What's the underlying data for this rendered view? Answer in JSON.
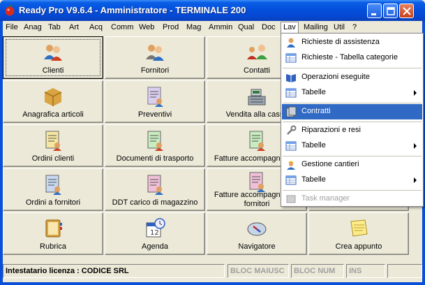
{
  "window": {
    "title": "Ready Pro V9.6.4 - Amministratore - TERMINALE 200"
  },
  "menubar": [
    {
      "label": "File"
    },
    {
      "label": "Anag"
    },
    {
      "label": "Tab"
    },
    {
      "label": "Art"
    },
    {
      "label": "Acq"
    },
    {
      "label": "Comm"
    },
    {
      "label": "Web"
    },
    {
      "label": "Prod"
    },
    {
      "label": "Mag"
    },
    {
      "label": "Ammin"
    },
    {
      "label": "Qual"
    },
    {
      "label": "Doc"
    },
    {
      "label": "Lav"
    },
    {
      "label": "Mailing"
    },
    {
      "label": "Util"
    },
    {
      "label": "?"
    }
  ],
  "tiles": [
    {
      "label": "Clienti",
      "icon": "users-icon"
    },
    {
      "label": "Fornitori",
      "icon": "suppliers-icon"
    },
    {
      "label": "Contatti",
      "icon": "contacts-icon"
    },
    {
      "label": "Anagrafica articoli",
      "icon": "box-icon"
    },
    {
      "label": "Preventivi",
      "icon": "quote-document-icon"
    },
    {
      "label": "Vendita alla cassa",
      "icon": "cash-register-icon"
    },
    {
      "label": "Ordini clienti",
      "icon": "order-document-icon"
    },
    {
      "label": "Documenti di trasporto",
      "icon": "transport-document-icon"
    },
    {
      "label": "Fatture accompagnatorie",
      "icon": "invoice-document-icon"
    },
    {
      "label": "Ordini a fornitori",
      "icon": "supplier-order-icon"
    },
    {
      "label": "DDT carico di magazzino",
      "icon": "warehouse-document-icon"
    },
    {
      "label": "Fatture accompagnatorie fornitori",
      "icon": "supplier-invoice-icon"
    },
    {
      "label": "Rubrica",
      "icon": "address-book-icon"
    },
    {
      "label": "Agenda",
      "icon": "calendar-clock-icon"
    },
    {
      "label": "Navigatore",
      "icon": "compass-icon"
    },
    {
      "label": "Crea appunto",
      "icon": "note-icon"
    }
  ],
  "dropdown": {
    "items": [
      {
        "label": "Richieste di assistenza",
        "icon": "person-icon",
        "submenu": false,
        "highlighted": false,
        "disabled": false
      },
      {
        "label": "Richieste - Tabella categorie",
        "icon": "table-icon",
        "submenu": false,
        "highlighted": false,
        "disabled": false
      },
      {
        "label": "Operazioni eseguite",
        "icon": "book-icon",
        "submenu": false,
        "highlighted": false,
        "disabled": false
      },
      {
        "label": "Tabelle",
        "icon": "table-icon",
        "submenu": true,
        "highlighted": false,
        "disabled": false
      },
      {
        "label": "Contratti",
        "icon": "contract-icon",
        "submenu": false,
        "highlighted": true,
        "disabled": false
      },
      {
        "label": "Riparazioni e resi",
        "icon": "wrench-icon",
        "submenu": false,
        "highlighted": false,
        "disabled": false
      },
      {
        "label": "Tabelle",
        "icon": "table-icon",
        "submenu": true,
        "highlighted": false,
        "disabled": false
      },
      {
        "label": "Gestione cantieri",
        "icon": "worker-icon",
        "submenu": false,
        "highlighted": false,
        "disabled": false
      },
      {
        "label": "Tabelle",
        "icon": "table-icon",
        "submenu": true,
        "highlighted": false,
        "disabled": false
      },
      {
        "label": "Task manager",
        "icon": "task-icon",
        "submenu": false,
        "highlighted": false,
        "disabled": true
      }
    ]
  },
  "statusbar": {
    "license": "Intestatario licenza : CODICE SRL",
    "caps": "BLOC MAIUSC",
    "num": "BLOC NUM",
    "ins": "INS"
  },
  "colors": {
    "titlebar": "#0550dc",
    "menu_highlight": "#316ac5",
    "face": "#ece9d8"
  }
}
